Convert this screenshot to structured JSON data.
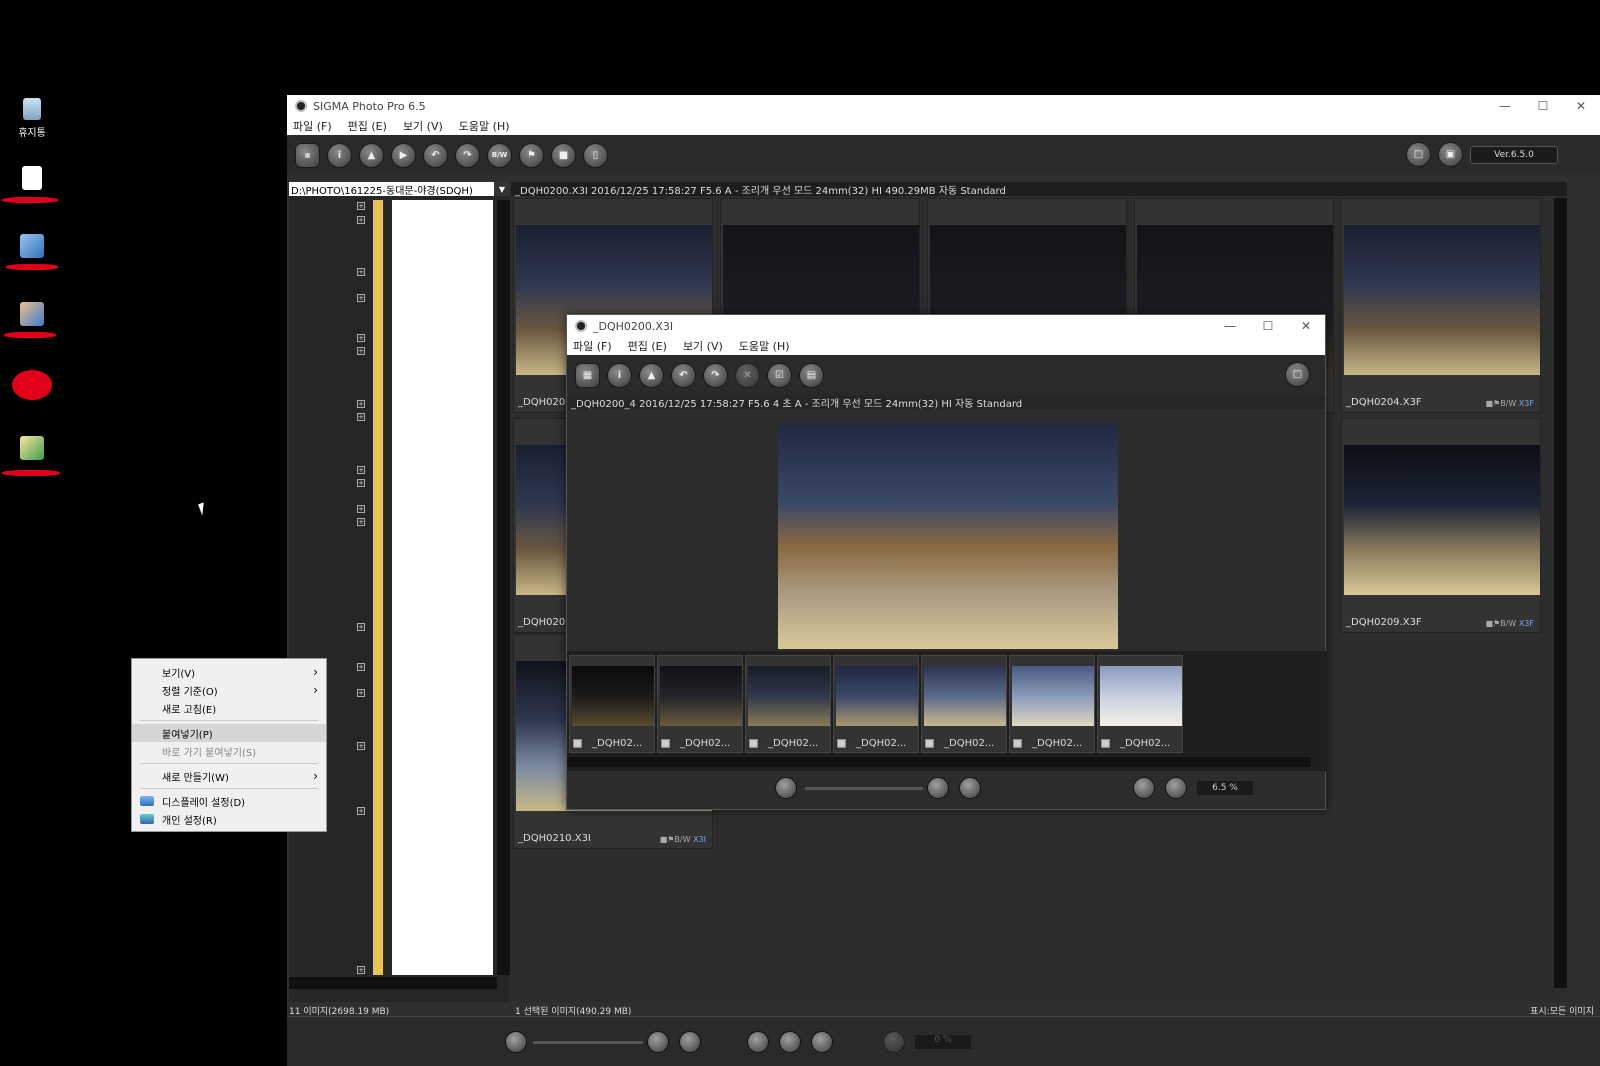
{
  "desktop": {
    "recycle_bin_label": "휴지통",
    "icons": [
      "recycle-bin-icon",
      "file-icon",
      "network-icon",
      "users-icon",
      "warning-icon",
      "user-file-icon"
    ]
  },
  "main_window": {
    "title": "SIGMA Photo Pro 6.5",
    "menu": [
      "파일 (F)",
      "편집 (E)",
      "보기 (V)",
      "도움말 (H)"
    ],
    "toolbar_buttons": [
      "JPEG-TIFF",
      "i",
      "stamp",
      "play",
      "rotate-left",
      "rotate-right",
      "B/W",
      "flag",
      "lock",
      "trash"
    ],
    "version": "Ver.6.5.0",
    "path": "D:\\PHOTO\\161225-동대문-야경(SDQH)",
    "info_bar": "_DQH0200.X3I 2016/12/25 17:58:27 F5.6 A - 조리개 우선 모드 24mm(32) HI 490.29MB 자동 Standard",
    "thumbnails": [
      {
        "name": "_DQH020"
      },
      {
        "name": ""
      },
      {
        "name": ""
      },
      {
        "name": ""
      },
      {
        "name": "_DQH0204.X3F",
        "badge": "X3F"
      },
      {
        "name": "_DQH020"
      },
      {
        "name": "_DQH0209.X3F",
        "badge": "X3F"
      },
      {
        "name": "_DQH0210.X3I",
        "badge": "X3I"
      }
    ],
    "badge_bw": "B/W",
    "left_status": "11 이미지(2698.19 MB)",
    "status_selected": "1 선택된 이미지(490.29 MB)",
    "status_right": "표시:모든 이미지",
    "zoom": "0 %"
  },
  "child_window": {
    "title": "_DQH0200.X3I",
    "menu": [
      "파일 (F)",
      "편집 (E)",
      "보기 (V)",
      "도움말 (H)"
    ],
    "info_bar": "_DQH0200_4 2016/12/25 17:58:27 F5.6 4 초 A - 조리개 우선 모드 24mm(32) HI 자동 Standard",
    "film": [
      "_DQH02...",
      "_DQH02...",
      "_DQH02...",
      "_DQH02...",
      "_DQH02...",
      "_DQH02...",
      "_DQH02..."
    ],
    "zoom": "6.5 %"
  },
  "context_menu": {
    "items": [
      {
        "label": "보기(V)",
        "submenu": true
      },
      {
        "label": "정렬 기준(O)",
        "submenu": true
      },
      {
        "label": "새로 고침(E)"
      },
      {
        "label": "붙여넣기(P)",
        "highlight": true
      },
      {
        "label": "바로 가기 붙여넣기(S)",
        "disabled": true
      },
      {
        "label": "새로 만들기(W)",
        "submenu": true
      },
      {
        "label": "디스플레이 설정(D)"
      },
      {
        "label": "개인 설정(R)"
      }
    ]
  }
}
